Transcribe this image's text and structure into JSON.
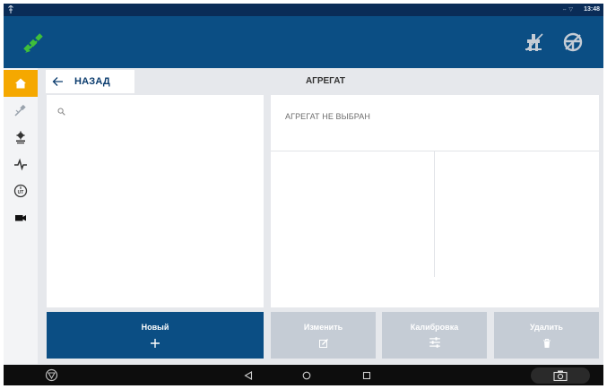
{
  "status_bar": {
    "signal_text": "⇔ ▽",
    "time": "13:48"
  },
  "app_bar": {
    "icons": [
      "satellite-icon",
      "implement-icon",
      "steering-wheel-icon"
    ]
  },
  "sidebar": {
    "items": [
      {
        "name": "home",
        "icon": "home-icon",
        "active": true
      },
      {
        "name": "guidance",
        "icon": "guidance-icon",
        "active": false
      },
      {
        "name": "machine",
        "icon": "machine-settings-icon",
        "active": false
      },
      {
        "name": "diagnostics",
        "icon": "diagnostics-icon",
        "active": false
      },
      {
        "name": "isobus",
        "icon": "isobus-ut-icon",
        "active": false
      },
      {
        "name": "camera",
        "icon": "camera-icon",
        "active": false
      }
    ]
  },
  "header": {
    "back_label": "НАЗАД",
    "title": "АГРЕГАТ"
  },
  "left_panel": {
    "search_icon": "search-icon"
  },
  "right_panel": {
    "none_selected": "АГРЕГАТ НЕ ВЫБРАН"
  },
  "buttons": {
    "new": "Новый",
    "edit": "Изменить",
    "calibration": "Калибровка",
    "delete": "Удалить"
  },
  "colors": {
    "primary": "#0b4e84",
    "status_bar": "#0a2c57",
    "accent": "#f5a800",
    "disabled": "#c5ccd5",
    "background": "#e6e8ec"
  }
}
